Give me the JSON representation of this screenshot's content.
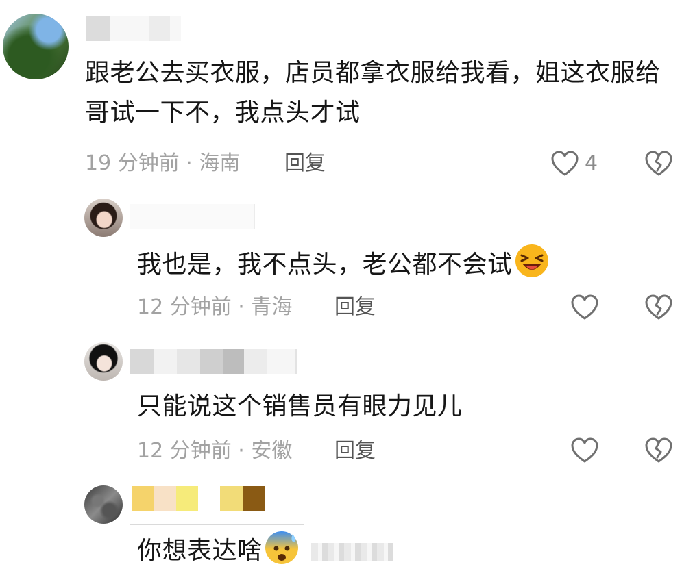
{
  "comments": [
    {
      "text": "跟老公去买衣服，店员都拿衣服给我看，姐这衣服给哥试一下不，我点头才试",
      "time": "19 分钟前",
      "location": "海南",
      "reply_label": "回复",
      "like_count": "4"
    },
    {
      "text": "我也是，我不点头，老公都不会试",
      "time": "12 分钟前",
      "location": "青海",
      "reply_label": "回复",
      "like_count": ""
    },
    {
      "text": "只能说这个销售员有眼力见儿",
      "time": "12 分钟前",
      "location": "安徽",
      "reply_label": "回复",
      "like_count": ""
    },
    {
      "text": "你想表达啥",
      "time": "",
      "location": "",
      "reply_label": "",
      "like_count": ""
    }
  ],
  "separator": " · ",
  "icons": [
    "heart-outline-icon",
    "broken-heart-icon",
    "laughing-emoji-icon",
    "cold-sweat-emoji-icon"
  ],
  "colors": {
    "text": "#161616",
    "meta": "#a2a2a2",
    "reply": "#545454",
    "icon": "#707070"
  }
}
